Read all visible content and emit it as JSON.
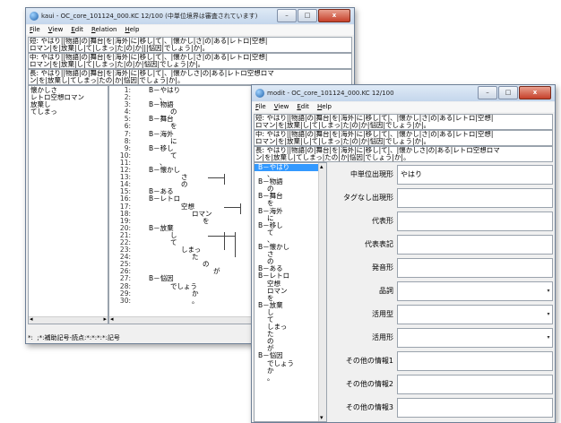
{
  "back_window": {
    "title": "kaui - OC_core_101124_000.KC 12/100 (中単位境界は審査されています)",
    "menu": [
      {
        "label": "File",
        "u": "F"
      },
      {
        "label": "View",
        "u": "V"
      },
      {
        "label": "Edit",
        "u": "E"
      },
      {
        "label": "Relation",
        "u": "R"
      },
      {
        "label": "Help",
        "u": "H"
      }
    ],
    "rows": [
      {
        "label": "短:",
        "line1": " やはり||物語|の|舞台|を|海外|に|移し|て|、|懐かし|さ|の|ある|レトロ|空想|",
        "line2": "ロマン|を|放棄|し|て|しまっ|た|の|か|||悩因|でしょう|か|。"
      },
      {
        "label": "中:",
        "line1": " やはり||物語|の|舞台|を|海外|に|移し|て|、|懐かし|さ|の|ある|レトロ|空想|",
        "line2": "ロマン|を|放棄|し|て|しまっ|た|の|か|悩因|でしょう|か|。"
      },
      {
        "label": "長:",
        "line1": " やはり||物語|の|舞台|を|海外|に|移し|て|、|懐かしさ|の|ある|レトロ空想ロマ",
        "line2": "ン|を|放棄し|てしまっ|たの|か|悩因|でしょう|か|。"
      }
    ],
    "left_list": [
      "懐かしさ",
      "レトロ空想ロマン",
      "放棄し",
      "てしまっ"
    ],
    "tree": [
      {
        "n": "1:",
        "t": "B－やはり",
        "i": 0
      },
      {
        "n": "2:",
        "t": "、",
        "i": 1
      },
      {
        "n": "3:",
        "t": "B－物語",
        "i": 0
      },
      {
        "n": "4:",
        "t": "の",
        "i": 2
      },
      {
        "n": "5:",
        "t": "B－舞台",
        "i": 0
      },
      {
        "n": "6:",
        "t": "を",
        "i": 2
      },
      {
        "n": "7:",
        "t": "B－海外",
        "i": 0
      },
      {
        "n": "8:",
        "t": "に",
        "i": 2
      },
      {
        "n": "9:",
        "t": "B－移し",
        "i": 0
      },
      {
        "n": "10:",
        "t": "て",
        "i": 2
      },
      {
        "n": "11:",
        "t": "、",
        "i": 1
      },
      {
        "n": "12:",
        "t": "B－懐かし",
        "i": 0
      },
      {
        "n": "13:",
        "t": "さ",
        "i": 3
      },
      {
        "n": "14:",
        "t": "の",
        "i": 3
      },
      {
        "n": "15:",
        "t": "B－ある",
        "i": 0
      },
      {
        "n": "16:",
        "t": "B－レトロ",
        "i": 0
      },
      {
        "n": "17:",
        "t": "空想",
        "i": 3
      },
      {
        "n": "18:",
        "t": "ロマン",
        "i": 4
      },
      {
        "n": "19:",
        "t": "を",
        "i": 5
      },
      {
        "n": "20:",
        "t": "B－放棄",
        "i": 0
      },
      {
        "n": "21:",
        "t": "し",
        "i": 2
      },
      {
        "n": "22:",
        "t": "て",
        "i": 2
      },
      {
        "n": "23:",
        "t": "しまっ",
        "i": 3
      },
      {
        "n": "24:",
        "t": "た",
        "i": 4
      },
      {
        "n": "25:",
        "t": "の",
        "i": 5
      },
      {
        "n": "26:",
        "t": "が",
        "i": 6
      },
      {
        "n": "27:",
        "t": "B－悩因",
        "i": 0
      },
      {
        "n": "28:",
        "t": "でしょう",
        "i": 2
      },
      {
        "n": "29:",
        "t": "か",
        "i": 4
      },
      {
        "n": "30:",
        "t": "。",
        "i": 4
      }
    ],
    "status": "*:  ;*:補助記号-読点:*:*:*:*:記号"
  },
  "front_window": {
    "title": "modit - OC_core_101124_000.KC 12/100",
    "menu": [
      {
        "label": "File",
        "u": "F"
      },
      {
        "label": "View",
        "u": "V"
      },
      {
        "label": "Edit",
        "u": "E"
      },
      {
        "label": "Help",
        "u": "H"
      }
    ],
    "rows": [
      {
        "label": "短:",
        "line1": " やはり||物語|の|舞台|を|海外|に|移し|て|、|懐かし|さ|の|ある|レトロ|空想|",
        "line2": "ロマン|を|放棄|し|て|しまっ|た|の|か|悩因|でしょう|か|。"
      },
      {
        "label": "中:",
        "line1": " やはり||物語|の|舞台|を|海外|に|移し|て|、|懐かし|さ|の|ある|レトロ|空想|",
        "line2": "ロマン|を|放棄|し|て|しまっ|た|の|か|悩因|でしょう|か|。"
      },
      {
        "label": "長:",
        "line1": " やはり||物語|の|舞台|を|海外|に|移し|て|、|懐かしさ|の|ある|レトロ空想ロマ",
        "line2": "ン|を|放棄し|てしまっ|たの|か|悩因|でしょう|か|。"
      }
    ],
    "list": [
      "B－やはり",
      "、",
      "B－物語",
      "の",
      "B－舞台",
      "を",
      "B－海外",
      "に",
      "B－移し",
      "て",
      "、",
      "B－懐かし",
      "さ",
      "の",
      "B－ある",
      "B－レトロ",
      "空想",
      "ロマン",
      "を",
      "B－放棄",
      "し",
      "て",
      "しまっ",
      "た",
      "の",
      "が",
      "B－悩因",
      "でしょう",
      "か",
      "。"
    ],
    "selected_index": 0,
    "fields": [
      {
        "label": "中単位出現形",
        "value": "やはり",
        "dropdown": false
      },
      {
        "label": "タグなし出現形",
        "value": "",
        "dropdown": false
      },
      {
        "label": "代表形",
        "value": "",
        "dropdown": false
      },
      {
        "label": "代表表記",
        "value": "",
        "dropdown": false
      },
      {
        "label": "発音形",
        "value": "",
        "dropdown": false
      },
      {
        "label": "品詞",
        "value": "",
        "dropdown": true
      },
      {
        "label": "活用型",
        "value": "",
        "dropdown": true
      },
      {
        "label": "活用形",
        "value": "",
        "dropdown": true
      },
      {
        "label": "その他の情報1",
        "value": "",
        "dropdown": false
      },
      {
        "label": "その他の情報2",
        "value": "",
        "dropdown": false
      },
      {
        "label": "その他の情報3",
        "value": "",
        "dropdown": false
      }
    ]
  },
  "controls": {
    "minimize": "–",
    "maximize": "□",
    "close": "x",
    "dropdown_arrow": "▾",
    "scroll_up": "▴",
    "scroll_down": "▾",
    "scroll_left": "◂",
    "scroll_right": "▸"
  }
}
